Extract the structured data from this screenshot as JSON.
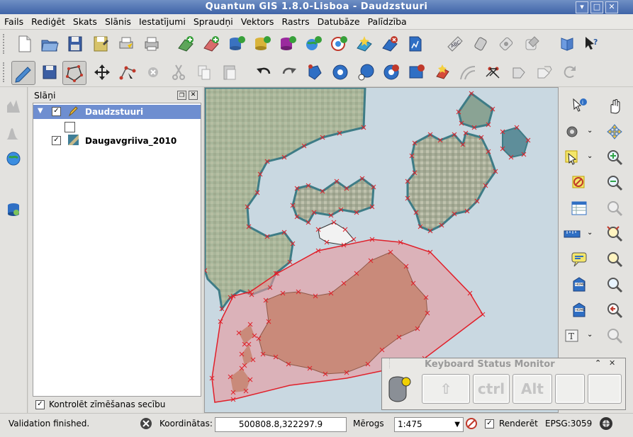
{
  "window": {
    "title": "Quantum GIS 1.8.0-Lisboa - Daudzstuuri",
    "buttons": [
      "▾",
      "□",
      "✕"
    ]
  },
  "menu": [
    "Fails",
    "Rediģēt",
    "Skats",
    "Slānis",
    "Iestatījumi",
    "Spraudņi",
    "Vektors",
    "Rastrs",
    "Datubāze",
    "Palīdzība"
  ],
  "layers_panel": {
    "title": "Slāņi",
    "layers": [
      {
        "name": "Daudzstuuri",
        "checked": true,
        "selected": true
      },
      {
        "name": "Daugavgriiva_2010",
        "checked": true,
        "selected": false
      }
    ],
    "render_order_label": "Kontrolēt zīmēšanas secību",
    "render_order_checked": true
  },
  "status": {
    "message": "Validation finished.",
    "coord_label": "Koordinātas:",
    "coord_value": "500808.8,322297.9",
    "scale_label": "Mērogs",
    "scale_value": "1:475",
    "render_label": "Renderēt",
    "render_checked": true,
    "crs": "EPSG:3059"
  },
  "keyboard_monitor": {
    "title": "Keyboard Status Monitor",
    "keys": [
      "⇧",
      "ctrl",
      "Alt",
      "",
      ""
    ]
  },
  "colors": {
    "titlebar": "#4a6db0",
    "selection": "#6e8ed0",
    "polygon_fill": "#e89a9e",
    "polygon_stroke": "#e0202a",
    "water": "#c4d7e0"
  }
}
